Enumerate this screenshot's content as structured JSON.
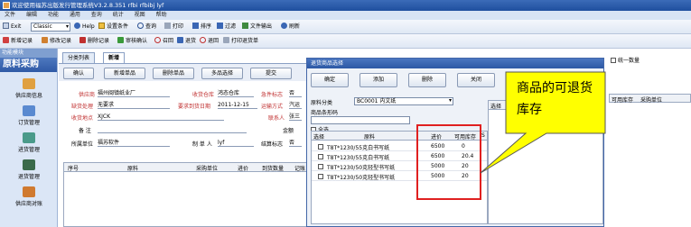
{
  "window": {
    "title": "欢迎使用福苏出版发行管理系统V3.2.8.351 rfbi rfbibj lyf"
  },
  "menu": [
    "文件",
    "编辑",
    "功能",
    "通用",
    "查询",
    "统计",
    "视图",
    "帮助"
  ],
  "toolbar1": {
    "exit": "Exit",
    "theme": "Classic",
    "help": "Help",
    "set_condition": "设置条件",
    "query": "查询",
    "print": "打印",
    "sort": "排序",
    "filter": "过滤",
    "export": "文件输出",
    "refresh": "刷新"
  },
  "toolbar2": {
    "new": "新增记录",
    "edit": "修改记录",
    "delete": "删除记录",
    "approve": "审核确认",
    "recall": "召回",
    "return_in": "退货",
    "return_back": "退回",
    "print_return": "打印退货单"
  },
  "sidebar": {
    "header": "功能模块",
    "section": "原料采购",
    "items": [
      "供应商信息",
      "订货管理",
      "进货管理",
      "退货管理",
      "供应商对账"
    ]
  },
  "tabs": [
    "分类列表",
    "新增"
  ],
  "inner_buttons": [
    "确认",
    "新增单品",
    "删除单品",
    "多品选择",
    "提交"
  ],
  "form": {
    "supplier_label": "供应商",
    "supplier_value": "福州闽镇纸业厂",
    "receiving_wh_label": "收货仓库",
    "receiving_wh_value": "鸿态仓库",
    "urgent_label": "急件标志",
    "urgent_value": "否",
    "reason_label": "缺货处理",
    "reason_value": "无要求",
    "required_date_label": "要求到货日期",
    "required_date_value": "2011-12-15",
    "transport_label": "运输方式",
    "transport_value": "汽运",
    "delivery_label": "收货地点",
    "delivery_value": "XJCK",
    "contact_label": "联系人",
    "contact_value": "张三",
    "note_label": "备  注",
    "amount_label": "金额",
    "unit_label": "所属单位",
    "unit_value": "福苏软件",
    "maker_label": "制 单 人",
    "maker_value": "lyf",
    "settle_label": "结算标志",
    "settle_value": "否"
  },
  "main_grid_headers": [
    "序号",
    "原料",
    "采购单位",
    "进价",
    "到货数量",
    "记账"
  ],
  "dialog": {
    "title": "退货商品选择",
    "buttons": [
      "确定",
      "添加",
      "删除",
      "关闭"
    ],
    "category_label": "原料分类",
    "category_value": "BC0001 内文纸",
    "barcode_label": "商品条形码",
    "select_all": "全选",
    "grid_headers": [
      "选择",
      "原料",
      "进价",
      "可用库存",
      "S"
    ],
    "rows": [
      {
        "name": "T8T*1230/55克白书写纸",
        "price": "6500",
        "stock": "0"
      },
      {
        "name": "T8T*1230/55克白书写纸",
        "price": "6500",
        "stock": "20.4"
      },
      {
        "name": "T8T*1230/50克轻型书写纸",
        "price": "5000",
        "stock": "20"
      },
      {
        "name": "T8T*1230/50克轻型书写纸",
        "price": "5000",
        "stock": "20"
      }
    ],
    "right_grid_headers": [
      "选择",
      "原料"
    ]
  },
  "right_panel": {
    "unify_qty": "统一数量",
    "headers": [
      "可用库存",
      "采购单位"
    ]
  },
  "callout": {
    "line1": "商品的可退货",
    "line2": "库存"
  }
}
